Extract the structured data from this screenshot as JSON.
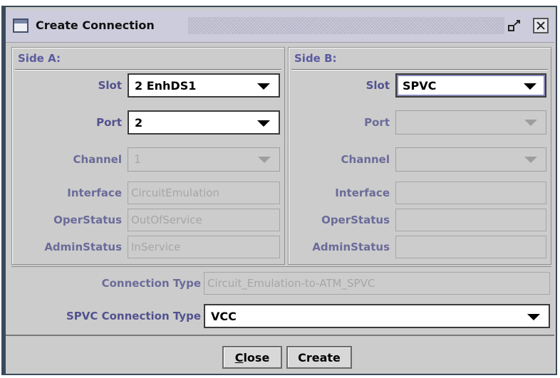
{
  "window": {
    "title": "Create Connection",
    "restore_icon": "restore-icon",
    "close_icon": "close-icon"
  },
  "side_a": {
    "header": "Side A:",
    "slot_label": "Slot",
    "slot_value": "2 EnhDS1",
    "port_label": "Port",
    "port_value": "2",
    "channel_label": "Channel",
    "channel_value": "1",
    "interface_label": "Interface",
    "interface_value": "CircuitEmulation",
    "operstatus_label": "OperStatus",
    "operstatus_value": "OutOfService",
    "adminstatus_label": "AdminStatus",
    "adminstatus_value": "InService"
  },
  "side_b": {
    "header": "Side B:",
    "slot_label": "Slot",
    "slot_value": "SPVC",
    "port_label": "Port",
    "port_value": "",
    "channel_label": "Channel",
    "channel_value": "",
    "interface_label": "Interface",
    "interface_value": "",
    "operstatus_label": "OperStatus",
    "operstatus_value": "",
    "adminstatus_label": "AdminStatus",
    "adminstatus_value": ""
  },
  "connection": {
    "type_label": "Connection Type",
    "type_value": "Circuit_Emulation-to-ATM_SPVC",
    "spvc_label": "SPVC Connection Type",
    "spvc_value": "VCC"
  },
  "buttons": {
    "close_first": "C",
    "close_rest": "lose",
    "create": "Create"
  }
}
